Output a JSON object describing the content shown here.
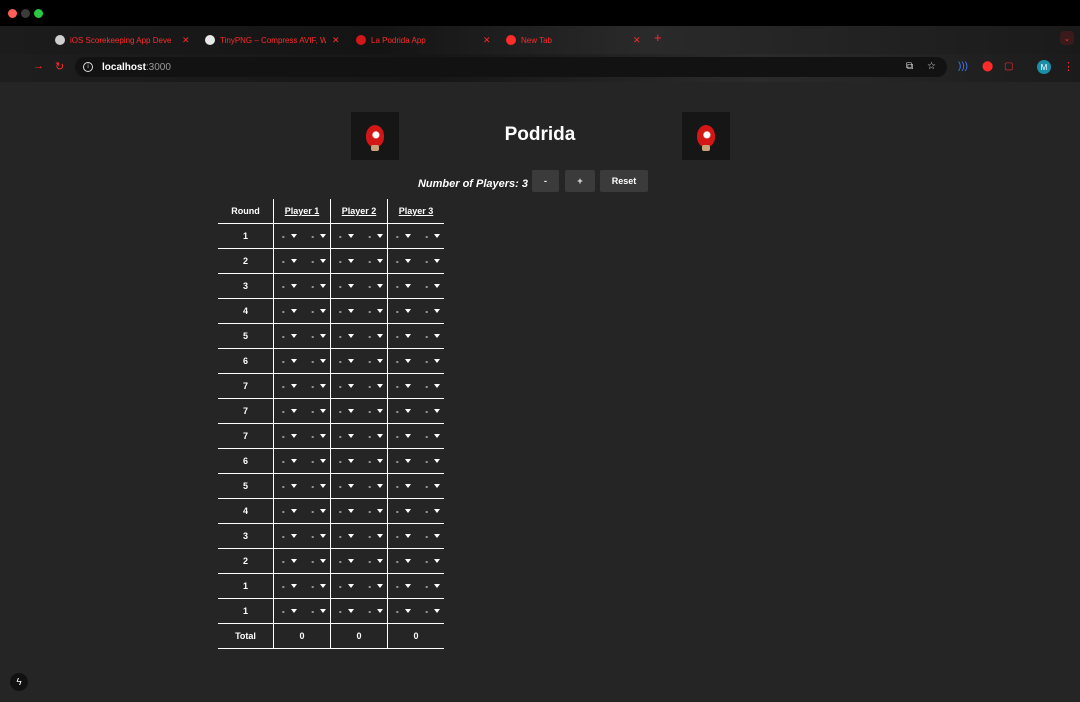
{
  "browser": {
    "tabs": [
      {
        "title": "iOS Scorekeeping App Deve",
        "favicon_color": "#cfcfcf"
      },
      {
        "title": "TinyPNG – Compress AVIF, W",
        "favicon_color": "#e8e8e8"
      },
      {
        "title": "La Podrida App",
        "favicon_color": "#d31616"
      },
      {
        "title": "New Tab",
        "favicon_color": "#ff2a2a"
      }
    ],
    "new_tab_glyph": "+",
    "close_glyph": "✕",
    "url_host": "localhost",
    "url_port": ":3000",
    "avatar_initial": "M",
    "accent_color": "#ff2a2a"
  },
  "app": {
    "title": "Podrida",
    "players_label": "Number of Players: 3",
    "minus_label": "-",
    "plus_label": "+",
    "reset_label": "Reset",
    "logo_icon": "mushroom-icon",
    "table": {
      "round_header": "Round",
      "players": [
        "Player 1",
        "Player 2",
        "Player 3"
      ],
      "rounds": [
        "1",
        "2",
        "3",
        "4",
        "5",
        "6",
        "7",
        "7",
        "7",
        "6",
        "5",
        "4",
        "3",
        "2",
        "1",
        "1"
      ],
      "select_placeholder": "-",
      "total_label": "Total",
      "totals": [
        "0",
        "0",
        "0"
      ]
    }
  },
  "devtools_icon": "bolt-icon"
}
